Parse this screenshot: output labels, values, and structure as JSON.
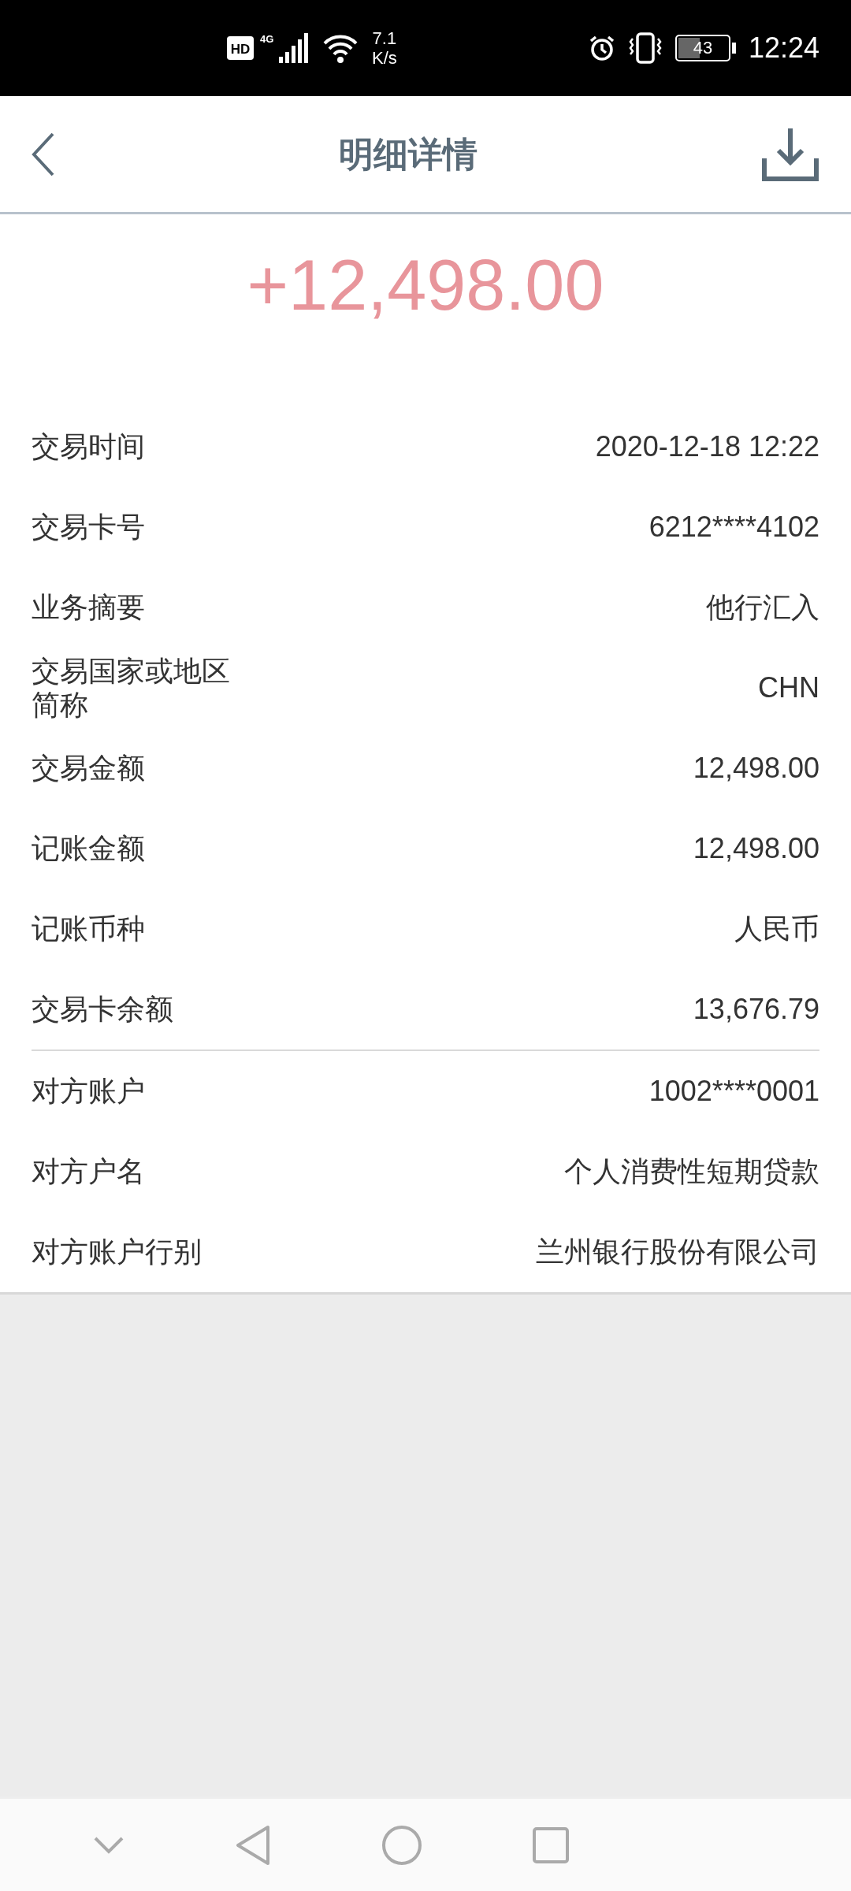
{
  "status_bar": {
    "hd_label": "HD",
    "network_type": "4G",
    "network_speed": "7.1",
    "network_speed_unit": "K/s",
    "battery": "43",
    "time": "12:24"
  },
  "header": {
    "title": "明细详情"
  },
  "amount": "+12,498.00",
  "sections": [
    {
      "rows": [
        {
          "label": "交易时间",
          "value": "2020-12-18 12:22"
        },
        {
          "label": "交易卡号",
          "value": "6212****4102"
        },
        {
          "label": "业务摘要",
          "value": "他行汇入"
        },
        {
          "label": "交易国家或地区简称",
          "value": "CHN"
        },
        {
          "label": "交易金额",
          "value": "12,498.00"
        },
        {
          "label": "记账金额",
          "value": "12,498.00"
        },
        {
          "label": "记账币种",
          "value": "人民币"
        },
        {
          "label": "交易卡余额",
          "value": "13,676.79"
        }
      ]
    },
    {
      "rows": [
        {
          "label": "对方账户",
          "value": "1002****0001"
        },
        {
          "label": "对方户名",
          "value": "个人消费性短期贷款"
        },
        {
          "label": "对方账户行别",
          "value": "兰州银行股份有限公司"
        }
      ]
    }
  ]
}
